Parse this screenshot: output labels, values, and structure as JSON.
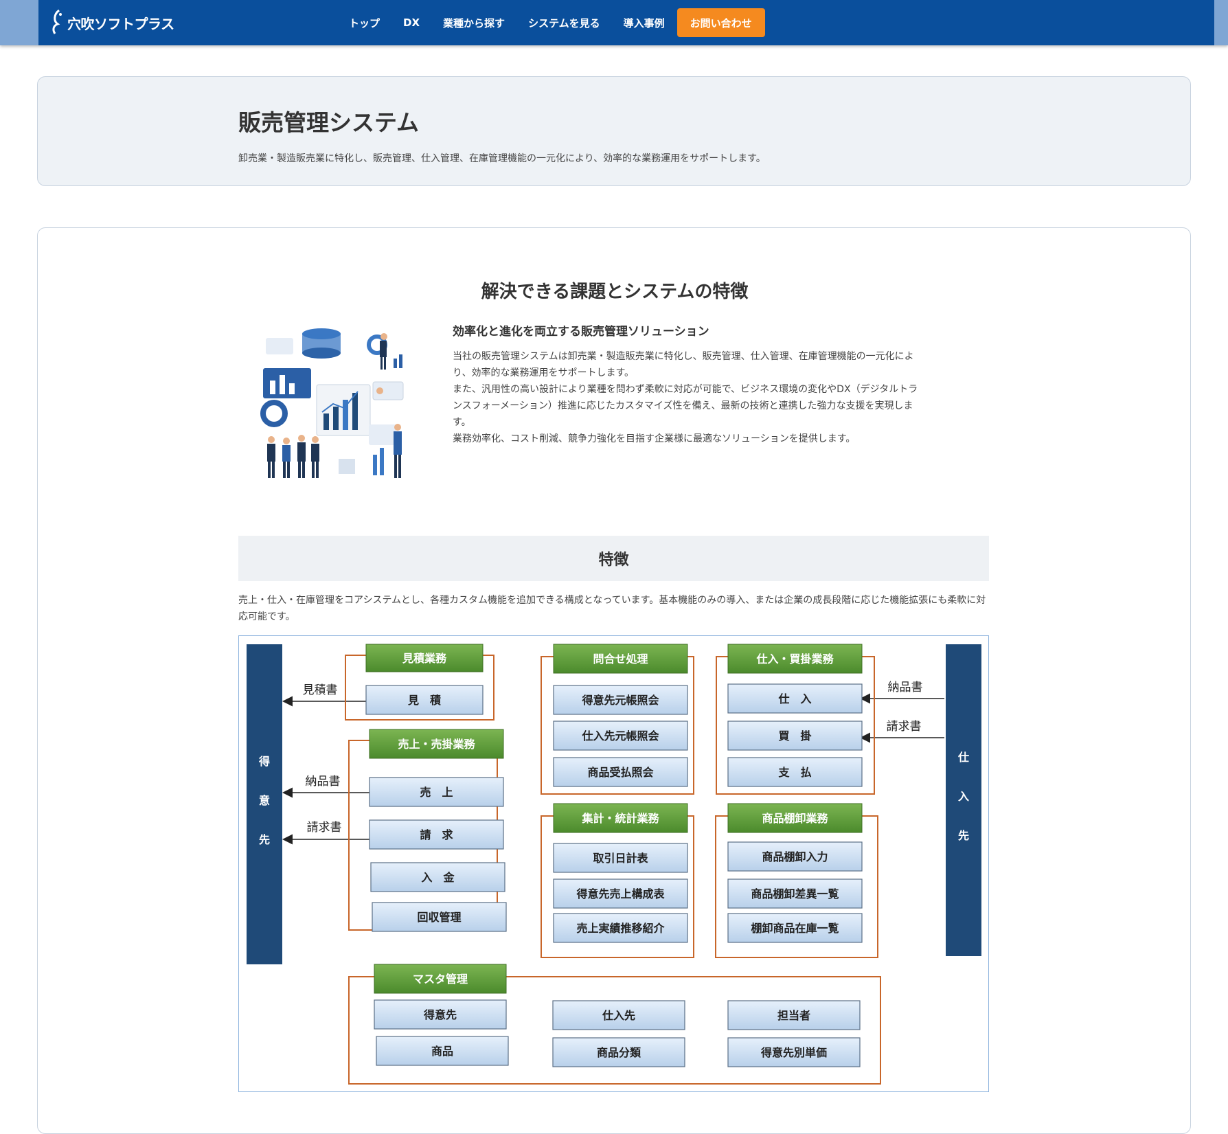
{
  "header": {
    "logo_text": "穴吹ソフトプラス",
    "nav": [
      "トップ",
      "DX",
      "業種から探す",
      "システムを見る",
      "導入事例"
    ],
    "cta": "お問い合わせ"
  },
  "hero": {
    "title": "販売管理システム",
    "lead": "卸売業・製造販売業に特化し、販売管理、仕入管理、在庫管理機能の一元化により、効率的な業務運用をサポートします。"
  },
  "intro": {
    "section_title": "解決できる課題とシステムの特徴",
    "subtitle": "効率化と進化を両立する販売管理ソリューション",
    "body": [
      "当社の販売管理システムは卸売業・製造販売業に特化し、販売管理、仕入管理、在庫管理機能の一元化により、効率的な業務運用をサポートします。",
      "また、汎用性の高い設計により業種を問わず柔軟に対応が可能で、ビジネス環境の変化やDX（デジタルトランスフォーメーション）推進に応じたカスタマイズ性を備え、最新の技術と連携した強力な支援を実現します。",
      "業務効率化、コスト削減、競争力強化を目指す企業様に最適なソリューションを提供します。"
    ]
  },
  "features": {
    "title": "特徴",
    "description": "売上・仕入・在庫管理をコアシステムとし、各種カスタム機能を追加できる構成となっています。基本機能のみの導入、または企業の成長段階に応じた機能拡張にも柔軟に対応可能です。"
  },
  "diagram": {
    "customer": "得意先",
    "supplier": "仕入先",
    "arrows_left": [
      "見積書",
      "納品書",
      "請求書"
    ],
    "arrows_right": [
      "納品書",
      "請求書"
    ],
    "groups": [
      {
        "title": "見積業務",
        "items": [
          "見　積"
        ]
      },
      {
        "title": "売上・売掛業務",
        "items": [
          "売　上",
          "請　求",
          "入　金",
          "回収管理"
        ]
      },
      {
        "title": "問合せ処理",
        "items": [
          "得意先元帳照会",
          "仕入先元帳照会",
          "商品受払照会"
        ]
      },
      {
        "title": "集計・統計業務",
        "items": [
          "取引日計表",
          "得意先売上構成表",
          "売上実績推移紹介"
        ]
      },
      {
        "title": "仕入・買掛業務",
        "items": [
          "仕　入",
          "買　掛",
          "支　払"
        ]
      },
      {
        "title": "商品棚卸業務",
        "items": [
          "商品棚卸入力",
          "商品棚卸差異一覧",
          "棚卸商品在庫一覧"
        ]
      },
      {
        "title": "マスタ管理",
        "items": [
          "得意先",
          "商品",
          "仕入先",
          "商品分類",
          "担当者",
          "得意先別単価"
        ]
      }
    ]
  },
  "colors": {
    "header_bg": "#0a4f9c",
    "cta_bg": "#f58a1f",
    "group_header": "#5a9a38",
    "group_border": "#c8662a",
    "side_bar": "#1f4a78",
    "item_fill": "#c9dcf0"
  }
}
